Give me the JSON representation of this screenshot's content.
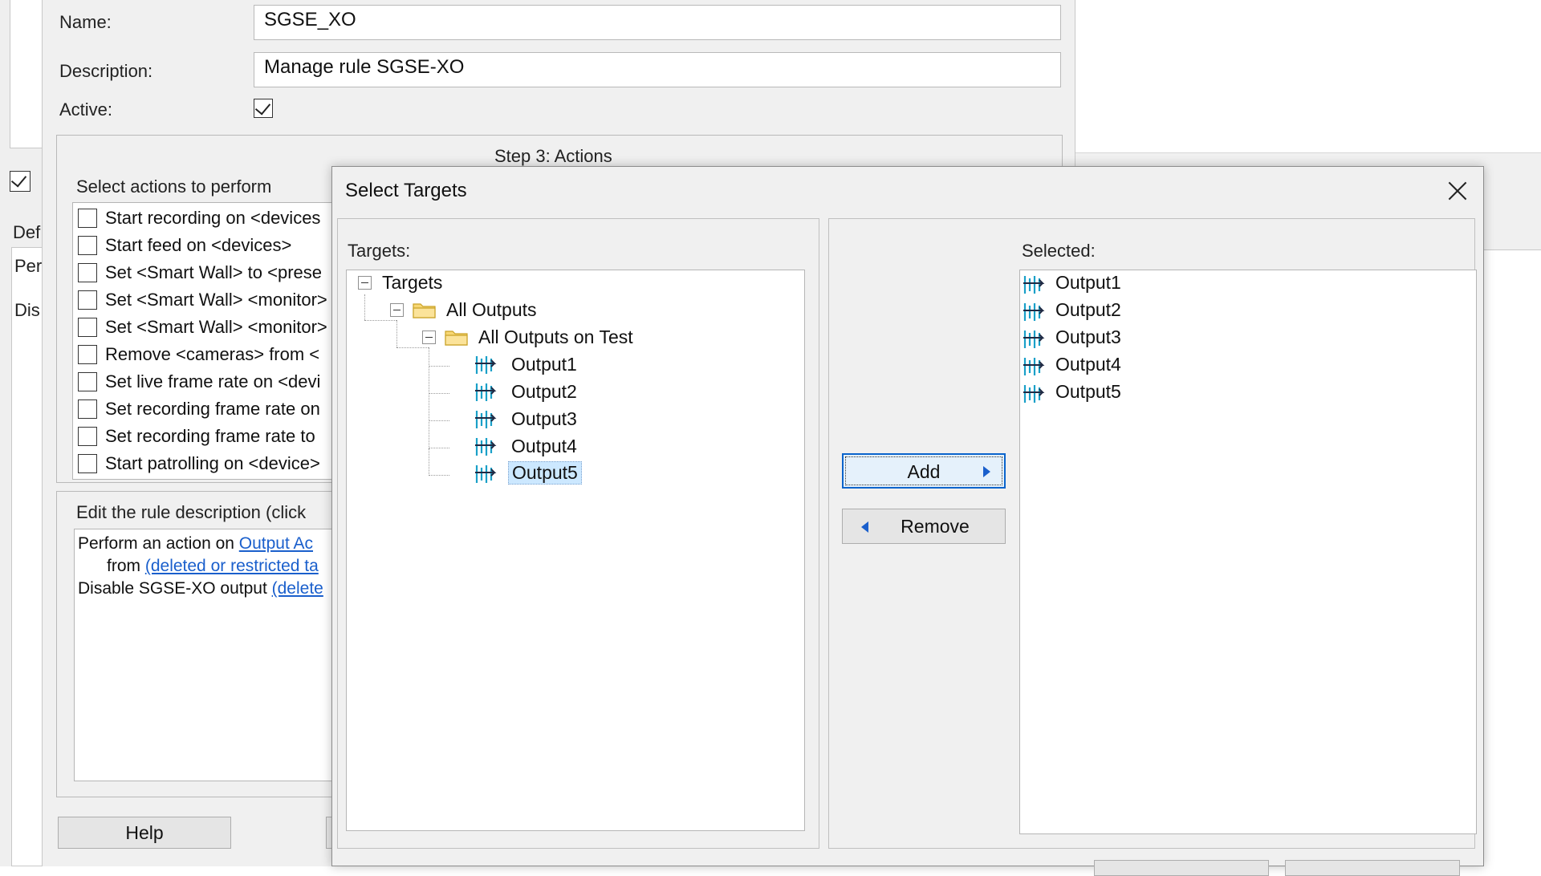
{
  "rule_form": {
    "name_label": "Name:",
    "name_value": "SGSE_XO",
    "description_label": "Description:",
    "description_value": "Manage  rule SGSE-XO",
    "active_label": "Active:",
    "active_checked": true,
    "step_title": "Step 3: Actions",
    "select_actions_label": "Select actions to perform",
    "actions": [
      "Start recording on <devices",
      "Start feed on <devices>",
      "Set <Smart Wall> to <prese",
      "Set <Smart Wall> <monitor>",
      "Set <Smart Wall> <monitor>",
      "Remove <cameras> from <",
      "Set live frame rate on <devi",
      "Set recording frame rate on",
      "Set recording frame rate to",
      "Start patrolling on <device>"
    ],
    "edit_desc_label": "Edit the rule description (click",
    "desc_line1_text": "Perform an action on ",
    "desc_line1_link": "Output  Ac",
    "desc_line2_text": "from ",
    "desc_line2_link": "(deleted or restricted ta",
    "desc_line3_text": "Disable SGSE-XO output ",
    "desc_line3_link": "(delete",
    "help_button": "Help"
  },
  "left_panel": {
    "label_def": "Def",
    "label_per": "Per",
    "label_dis": "Dis"
  },
  "dialog": {
    "title": "Select Targets",
    "targets_label": "Targets:",
    "selected_label": "Selected:",
    "tree": {
      "root": "Targets",
      "folder1": "All Outputs",
      "folder2": "All Outputs on Test",
      "outputs": [
        "Output1",
        "Output2",
        "Output3",
        "Output4",
        "Output5"
      ],
      "selected_item": "Output5"
    },
    "selected_items": [
      "Output1",
      "Output2",
      "Output3",
      "Output4",
      "Output5"
    ],
    "add_button": "Add",
    "remove_button": "Remove"
  },
  "icons": {
    "close": "close-icon",
    "folder": "folder-icon",
    "output": "output-icon",
    "arrow_right": "triangle-right-icon",
    "arrow_left": "triangle-left-icon",
    "expander": "collapse-icon"
  },
  "colors": {
    "link": "#1a5fcc",
    "selection": "#cce8ff",
    "add_button_border": "#0a64cc",
    "output_icon": "#1aa0c8"
  }
}
